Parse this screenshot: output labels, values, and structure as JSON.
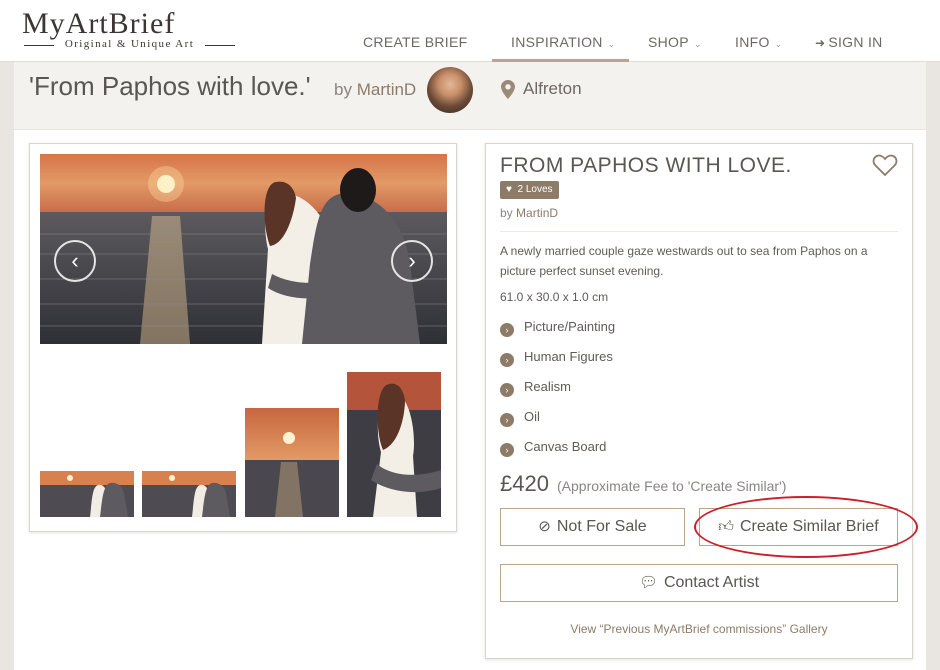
{
  "logo": {
    "main": "MyArtBrief",
    "sub": "Original & Unique Art"
  },
  "nav": {
    "items": [
      {
        "label": "CREATE BRIEF",
        "chevron": false
      },
      {
        "label": "INSPIRATION",
        "chevron": true,
        "active": true
      },
      {
        "label": "SHOP",
        "chevron": true
      },
      {
        "label": "INFO",
        "chevron": true
      },
      {
        "label": "SIGN IN",
        "icon": "sign-in-icon"
      }
    ]
  },
  "header": {
    "title": "'From Paphos with love.'",
    "by_prefix": "by",
    "artist": "MartinD",
    "location": "Alfreton"
  },
  "gallery": {
    "prev_glyph": "‹",
    "next_glyph": "›",
    "thumbnails": 4
  },
  "details": {
    "title": "FROM PAPHOS WITH LOVE.",
    "loves": "2 Loves",
    "by_prefix": "by",
    "artist": "MartinD",
    "description": "A newly married couple gaze westwards out to sea from Paphos on a picture perfect sunset evening.",
    "dimensions": "61.0 x 30.0 x 1.0 cm",
    "attributes": [
      "Picture/Painting",
      "Human Figures",
      "Realism",
      "Oil",
      "Canvas Board"
    ],
    "price": "£420",
    "price_note": "(Approximate Fee to 'Create Similar')",
    "not_for_sale": "Not For Sale",
    "create_similar": "Create Similar Brief",
    "contact": "Contact Artist",
    "gallery_link": "View “Previous MyArtBrief commissions” Gallery"
  },
  "colors": {
    "accent": "#8d7b68",
    "annotation": "#cc1f2b"
  }
}
